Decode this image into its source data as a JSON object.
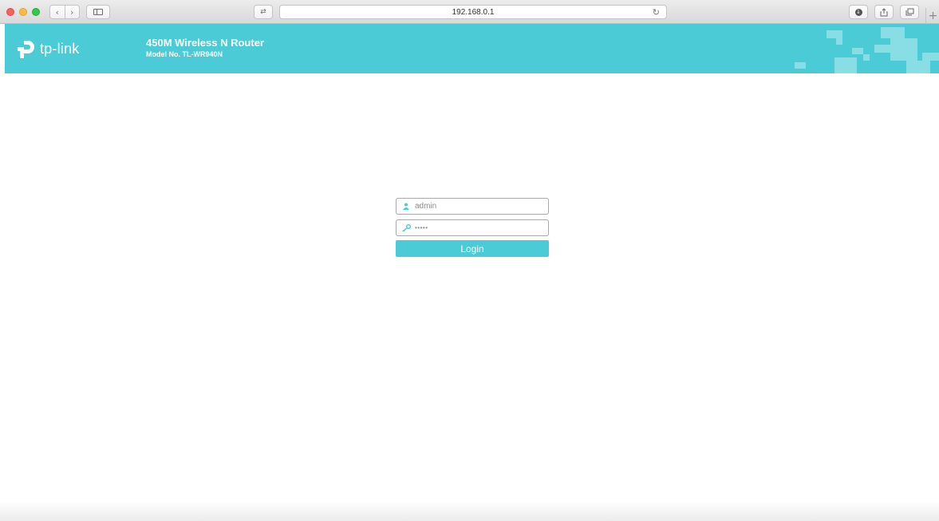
{
  "browser": {
    "url": "192.168.0.1",
    "nav_back_icon": "chevron-left-icon",
    "nav_forward_icon": "chevron-right-icon",
    "reload_icon": "reload-icon",
    "new_tab_label": "+"
  },
  "header": {
    "logo_text": "tp-link",
    "product_title": "450M Wireless N Router",
    "model_label": "Model No. TL-WR940N",
    "background_color": "#4acbd6"
  },
  "login": {
    "username_value": "admin",
    "password_value": "•••••",
    "login_label": "Login",
    "accent_color": "#4acbd6"
  }
}
